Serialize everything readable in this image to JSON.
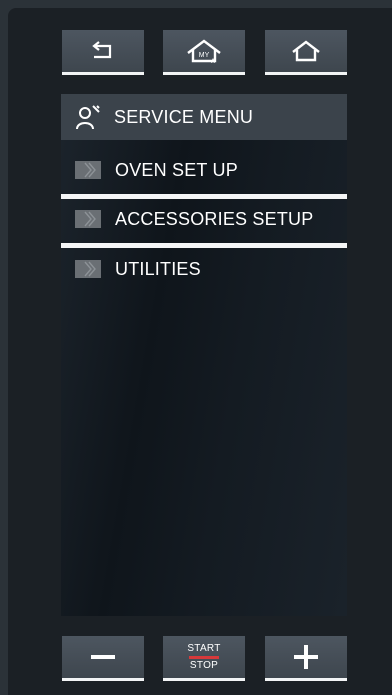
{
  "top_buttons": {
    "back_icon": "back-arrow-icon",
    "myhome_icon": "my-home-icon",
    "myhome_text": "MY",
    "home_icon": "home-icon"
  },
  "menu": {
    "header_label": "SERVICE MENU",
    "header_icon": "service-wrench-person-icon",
    "items": [
      {
        "label": "OVEN SET UP",
        "icon": "chevron-right-double-icon"
      },
      {
        "label": "ACCESSORIES SETUP",
        "icon": "chevron-right-double-icon"
      },
      {
        "label": "UTILITIES",
        "icon": "chevron-right-double-icon"
      }
    ]
  },
  "bottom_buttons": {
    "minus_icon": "minus-icon",
    "start_top": "START",
    "start_bottom": "STOP",
    "plus_icon": "plus-icon"
  },
  "colors": {
    "background": "#2b3238",
    "button": "#464f57",
    "header": "#3b434b",
    "accent_red": "#d6393b",
    "underline": "#f2f4f5"
  }
}
